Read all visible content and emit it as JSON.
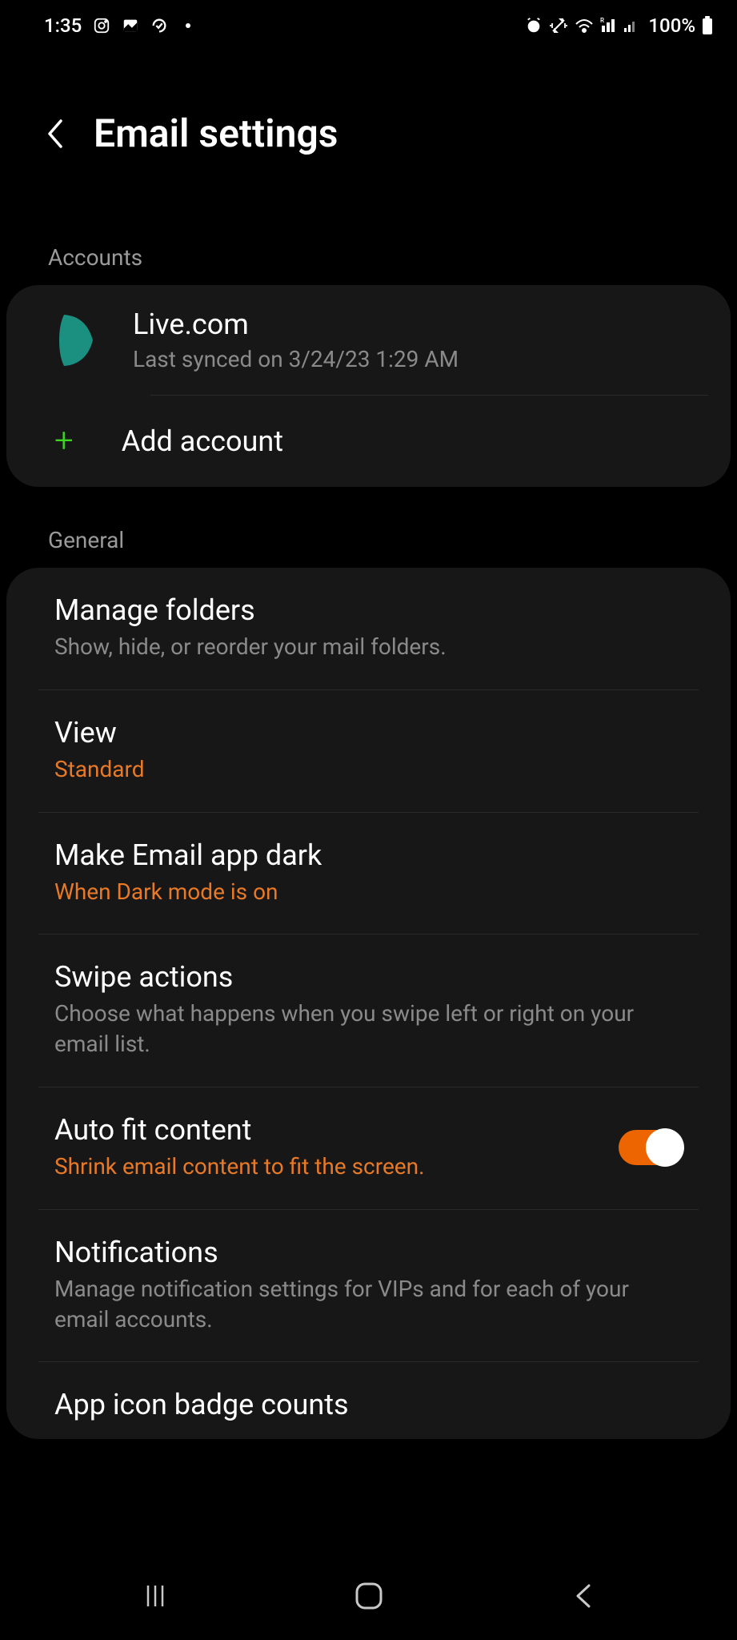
{
  "status": {
    "time": "1:35",
    "battery": "100%"
  },
  "header": {
    "title": "Email settings"
  },
  "sections": {
    "accounts_label": "Accounts",
    "general_label": "General"
  },
  "account": {
    "name": "Live.com",
    "sync": "Last synced on 3/24/23  1:29 AM"
  },
  "add_account": {
    "label": "Add account"
  },
  "settings": {
    "manage_folders": {
      "title": "Manage folders",
      "sub": "Show, hide, or reorder your mail folders."
    },
    "view": {
      "title": "View",
      "sub": "Standard"
    },
    "dark": {
      "title": "Make Email app dark",
      "sub": "When Dark mode is on"
    },
    "swipe": {
      "title": "Swipe actions",
      "sub": "Choose what happens when you swipe left or right on your email list."
    },
    "autofit": {
      "title": "Auto fit content",
      "sub": "Shrink email content to fit the screen."
    },
    "notifications": {
      "title": "Notifications",
      "sub": "Manage notification settings for VIPs and for each of your email accounts."
    },
    "badge": {
      "title": "App icon badge counts"
    }
  }
}
